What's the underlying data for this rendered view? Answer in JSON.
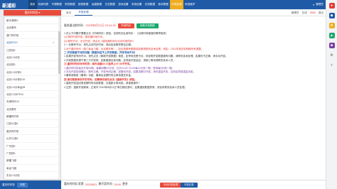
{
  "nav": {
    "logo": "新浦彩",
    "items": [
      "首页",
      "玩家列表",
      "代理数据",
      "财务数据",
      "报表数据",
      "运营数据",
      "日志数据",
      "游戏设置",
      "系统设置",
      "在线数据",
      "版本数据",
      "开奖处理",
      "系统维护"
    ],
    "active_index": 0,
    "current_index": 11,
    "right_label": "管理员"
  },
  "dropdown": {
    "header": "重庆时时彩",
    "items": [
      "新天津快3",
      "北京赛车",
      "澳门时时彩",
      "北京PK10",
      "江苏快3",
      "北京1.5分彩",
      "北京快3",
      "北京1.5分快3",
      "北京1.5分快乐10",
      "北京1.5分幸运28",
      "北京1.5分PK10",
      "天津快乐10",
      "北京赛车",
      "新疆时时彩",
      "江西11选5",
      "重庆时时彩",
      "山东11选5",
      "广东快3",
      "广西快3",
      "新疆飞艇",
      "幸运飞艇",
      "东京1.5分彩"
    ],
    "selected_index": 3
  },
  "tabs": [
    "首页",
    "开奖处理"
  ],
  "info": {
    "user_label": "管理员",
    "online_label": "在线",
    "count": "3569",
    "logout": "退出"
  },
  "timebar": {
    "label": "服务器当前时间:",
    "time": "2023年8月21日 23:44:28",
    "btn_sync": "时间同步",
    "btn_refresh": "刷新开奖数据"
  },
  "notes": [
    {
      "t": "1.在以下问题才需要点击《时间同步》按钮，否则别去乱用同步：（出现时间错误的概率极低）",
      "c": "c-dark"
    },
    {
      "t": "(1).刚好时间开奖，服务器时间不对。",
      "c": "c-red"
    },
    {
      "t": "(2).期号不对，无法开奖，请点击《服务器时间与北京时间同步》",
      "c": "c-red"
    },
    {
      "t": "2.一旦期号不对，请先点击同步时间，然后检查期号是否正确。",
      "c": "c-dark"
    },
    {
      "t": "3.对于重庆系列（澳门幸运飞艇、北京赛车等），如出现期号跳期或延期请联系技术处理，例如：2021年某些彩种期号有调整。",
      "c": "c-red"
    },
    {
      "t": "二.开奖数据不对的问题（数据对应不上开奖数据，开奖号码不对）",
      "c": "c-blue b"
    },
    {
      "t": "1.如果开奖号码不对，请先点击《刷新开奖数据》按钮，如号码还是不对，则说明开奖数据源有问题，请联系技术处理。如果仍不正确，请手动开奖。",
      "c": "c-dark"
    },
    {
      "t": "2.开奖数据来源于第三方开奖网，如数据源出现问题，会导致开奖延迟，请耐心等待或联系技术人员。",
      "c": "c-dark"
    },
    {
      "t": "三.重庆时时彩休市时间：每天凌晨03:10至早上07:30不开奖。",
      "c": "c-red b"
    },
    {
      "t": "1.重庆时时彩每天开奖59期，每期间隔20分钟，白天10:00~22:00每10分钟一期，夜场每5分钟一期。",
      "c": "c-purple"
    },
    {
      "t": "2.手动开奖前请确认：期号正确、开奖号码正确、该期未开奖；如果该期已开奖，请勿重复开奖，否则会导致重复派奖。",
      "c": "c-purple"
    },
    {
      "t": "3.撤单请使用《撤单》功能，撤单后该期所有注单将退还本金。",
      "c": "c-dark"
    },
    {
      "t": "四.请勿随意修改开奖号码，如需修改请先点击《重新开奖》按钮。",
      "c": "c-red b"
    },
    {
      "t": "1.重新开奖会回滚该期所有派奖数据，并重新计算派奖。请谨慎操作！",
      "c": "c-dark"
    },
    {
      "t": "2.注意：重新开奖期间，正常写\"2019年8月21日\"等日期记录时，如果遇到数据异常，请及时联系技术人员处理。",
      "c": "c-dark"
    }
  ],
  "bottom": {
    "left_label": "重庆时时彩",
    "left_btn": "开奖",
    "status_prefix": "重庆时时彩 距第",
    "period": "20230821",
    "status_mid": "期开奖时间:",
    "countdown": "00:00",
    "status_suffix": "更多",
    "btn_manual": "手动开奖处理",
    "btn_history": "开奖记录"
  },
  "colors": {
    "nav": "#1f5aa6",
    "accent": "#e74c3c",
    "green": "#1aa86b"
  }
}
